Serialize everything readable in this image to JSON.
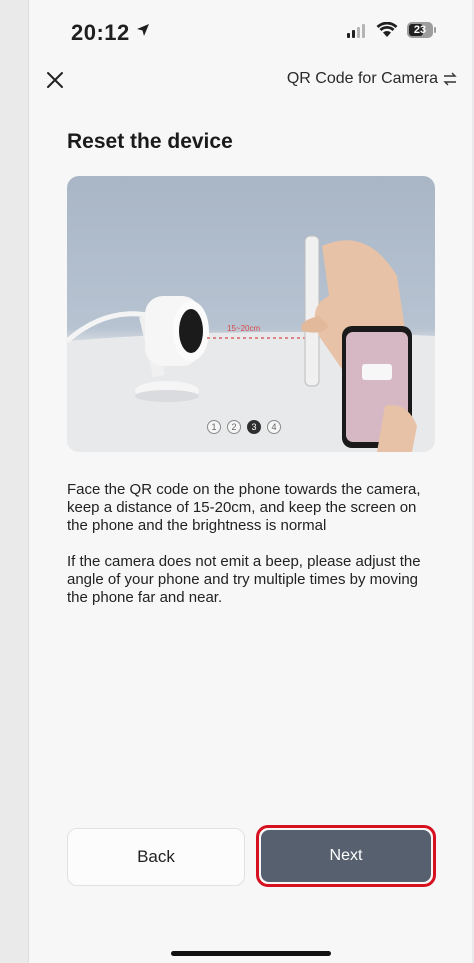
{
  "status_bar": {
    "time": "20:12",
    "battery": "23",
    "icons": [
      "location-arrow-icon",
      "signal-icon",
      "wifi-icon",
      "battery-icon"
    ]
  },
  "nav": {
    "close_icon": "close-icon",
    "title": "QR Code for Camera",
    "title_icon": "swap-icon"
  },
  "page": {
    "title": "Reset the device"
  },
  "illustration": {
    "distance_label": "15~20cm",
    "dots": [
      "1",
      "2",
      "3",
      "4"
    ],
    "active_dot": 3
  },
  "instructions": {
    "paragraph1": "Face the QR code on the phone towards the camera, keep a distance of 15-20cm, and keep the screen on the phone and the brightness is normal",
    "paragraph2": "If the camera does not emit a beep, please adjust the angle of your phone and try multiple times by moving the phone far and near."
  },
  "buttons": {
    "back": "Back",
    "next": "Next"
  },
  "colors": {
    "next_button": "#57606f",
    "highlight": "#d6101f",
    "background": "#f7f7f7"
  }
}
